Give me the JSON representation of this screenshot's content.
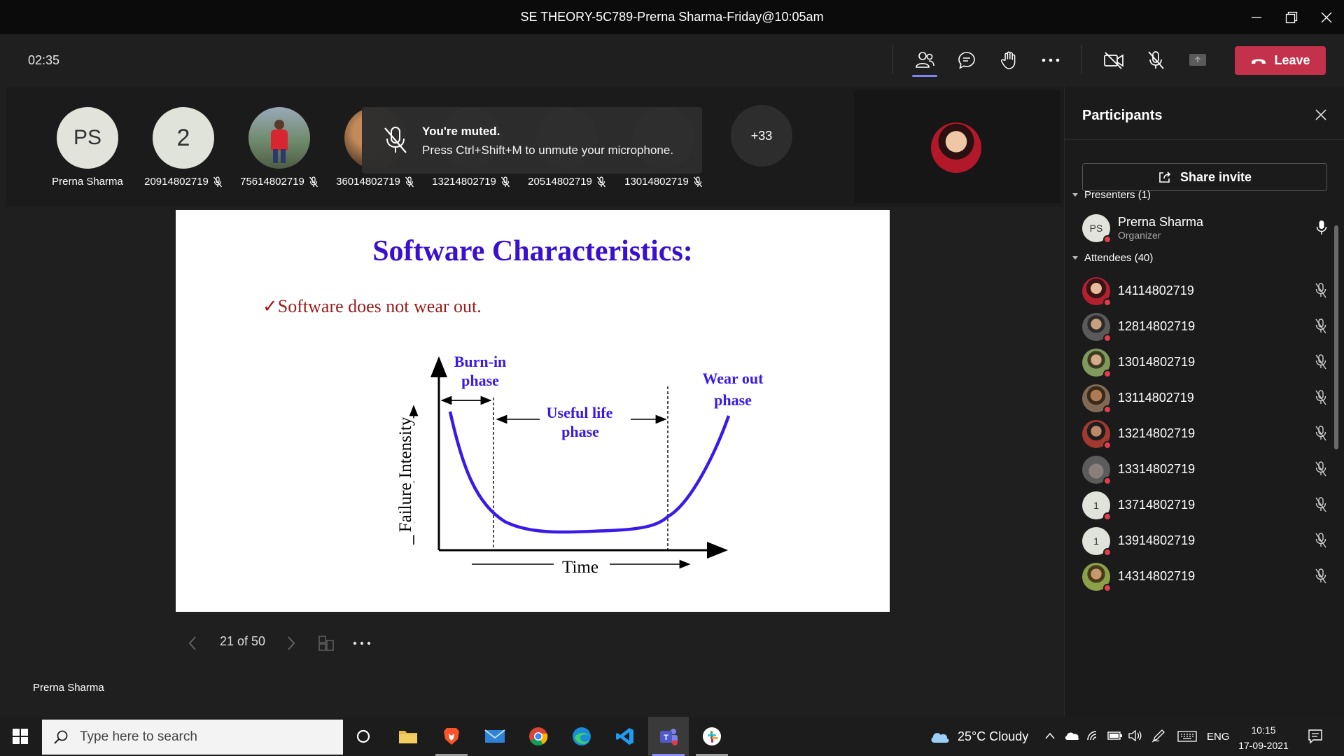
{
  "window": {
    "title": "SE THEORY-5C789-Prerna Sharma-Friday@10:05am"
  },
  "meeting": {
    "timer": "02:35",
    "leave_label": "Leave"
  },
  "strip": {
    "participants": [
      {
        "initials": "PS",
        "name": "Prerna Sharma"
      },
      {
        "initials": "2",
        "name": "20914802719"
      },
      {
        "initials": "",
        "name": "75614802719"
      },
      {
        "initials": "",
        "name": "36014802719"
      },
      {
        "initials": "",
        "name": "13214802719"
      },
      {
        "initials": "2",
        "name": "20514802719"
      },
      {
        "initials": "",
        "name": "13014802719"
      }
    ],
    "more_count": "+33"
  },
  "toast": {
    "heading": "You're muted.",
    "body": "Press Ctrl+Shift+M to unmute your microphone."
  },
  "slide": {
    "title": "Software Characteristics:",
    "bullet": "✓Software does not wear out.",
    "diagram": {
      "y_axis_label": "Failure Intensity",
      "x_axis_label": "Time",
      "phase1": [
        "Burn-in",
        "phase"
      ],
      "phase2": [
        "Useful life",
        "phase"
      ],
      "phase3": [
        "Wear out",
        "phase"
      ]
    },
    "page_indicator": "21 of 50",
    "presenter_name": "Prerna Sharma"
  },
  "panel": {
    "title": "Participants",
    "share_invite": "Share invite",
    "presenters_header": "Presenters (1)",
    "presenters": [
      {
        "initials": "PS",
        "name": "Prerna Sharma",
        "role": "Organizer"
      }
    ],
    "attendees_header": "Attendees (40)",
    "attendees": [
      {
        "initials": "",
        "name": "14114802719"
      },
      {
        "initials": "",
        "name": "12814802719"
      },
      {
        "initials": "",
        "name": "13014802719"
      },
      {
        "initials": "",
        "name": "13114802719"
      },
      {
        "initials": "",
        "name": "13214802719"
      },
      {
        "initials": "",
        "name": "13314802719"
      },
      {
        "initials": "1",
        "name": "13714802719"
      },
      {
        "initials": "1",
        "name": "13914802719"
      },
      {
        "initials": "",
        "name": "14314802719"
      }
    ]
  },
  "taskbar": {
    "search_placeholder": "Type here to search",
    "weather": "25°C  Cloudy",
    "language": "ENG",
    "time": "10:15",
    "date": "17-09-2021"
  }
}
